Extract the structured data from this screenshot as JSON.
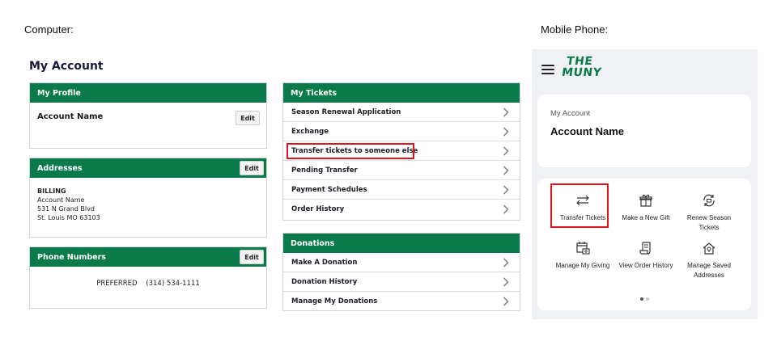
{
  "captions": {
    "computer": "Computer:",
    "mobile": "Mobile Phone:"
  },
  "desktop": {
    "title": "My Account",
    "edit_label": "Edit",
    "profile": {
      "heading": "My Profile",
      "account_name": "Account Name"
    },
    "addresses": {
      "heading": "Addresses",
      "type": "BILLING",
      "name": "Account Name",
      "street": "531 N Grand Blvd",
      "city": "St. Louis MO 63103"
    },
    "phones": {
      "heading": "Phone Numbers",
      "type": "PREFERRED",
      "number": "(314) 534-1111"
    },
    "tickets": {
      "heading": "My Tickets",
      "items": [
        {
          "label": "Season Renewal Application"
        },
        {
          "label": "Exchange"
        },
        {
          "label": "Transfer tickets to someone else"
        },
        {
          "label": "Pending Transfer"
        },
        {
          "label": "Payment Schedules"
        },
        {
          "label": "Order History"
        }
      ]
    },
    "donations": {
      "heading": "Donations",
      "items": [
        {
          "label": "Make A Donation"
        },
        {
          "label": "Donation History"
        },
        {
          "label": "Manage My Donations"
        }
      ]
    },
    "highlight_color": "#e0141e",
    "brand_color": "#0b7a4b"
  },
  "mobile": {
    "logo_line1": "THE",
    "logo_line2": "MUNY",
    "account": {
      "subtitle": "My Account",
      "name": "Account Name"
    },
    "actions": [
      {
        "label": "Transfer Tickets",
        "icon": "transfer-arrows-icon"
      },
      {
        "label": "Make a New Gift",
        "icon": "gift-icon"
      },
      {
        "label": "Renew Season Tickets",
        "icon": "renew-tickets-icon"
      },
      {
        "label": "Manage My Giving",
        "icon": "calendar-money-icon"
      },
      {
        "label": "View Order History",
        "icon": "receipt-icon"
      },
      {
        "label": "Manage Saved Addresses",
        "icon": "house-location-icon"
      }
    ],
    "page_indicator": {
      "current": 1,
      "total": 2
    }
  }
}
